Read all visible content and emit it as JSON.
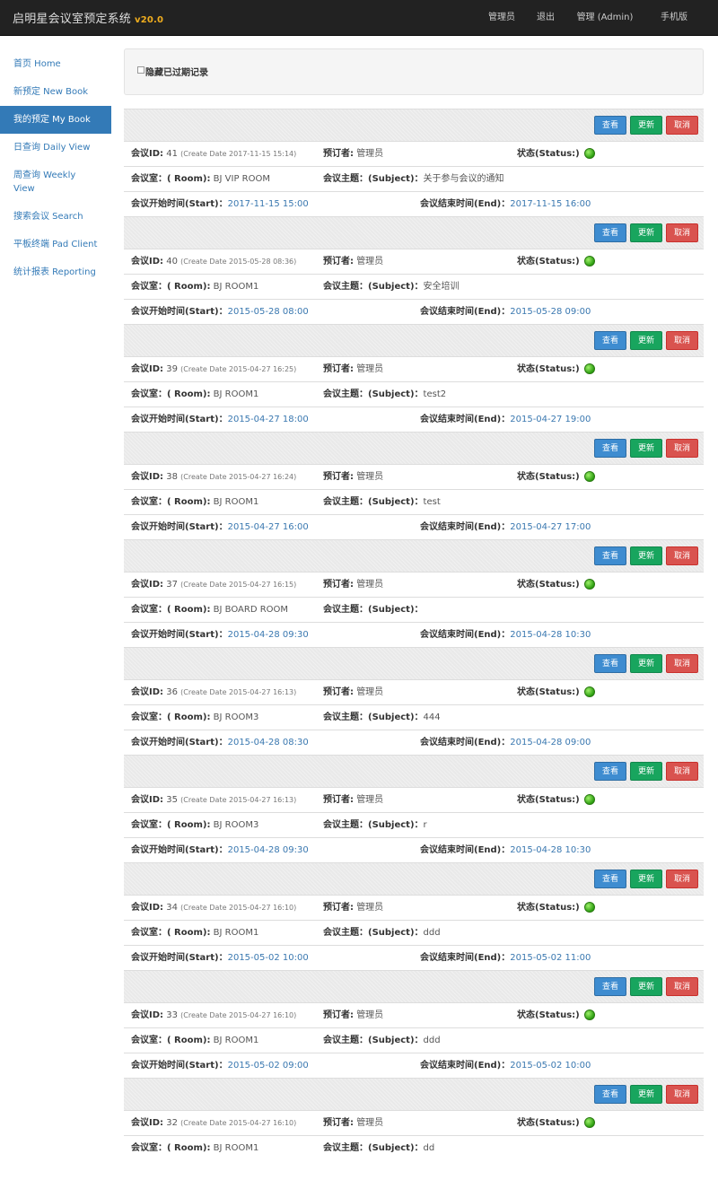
{
  "app": {
    "title": "启明星会议室预定系统",
    "version": "v20.0"
  },
  "nav": [
    {
      "label": "管理员",
      "x": 0
    },
    {
      "label": "退出"
    },
    {
      "label": "管理 (Admin)"
    },
    {
      "label": "手机版"
    }
  ],
  "sidebar": [
    {
      "label": "首页 Home",
      "active": false
    },
    {
      "label": "新预定 New Book",
      "active": false
    },
    {
      "label": "我的预定 My Book",
      "active": true
    },
    {
      "label": "日查询 Daily View",
      "active": false
    },
    {
      "label": "周查询 Weekly View",
      "active": false
    },
    {
      "label": "搜索会议 Search",
      "active": false
    },
    {
      "label": "平板终端 Pad Client",
      "active": false
    },
    {
      "label": "统计报表 Reporting",
      "active": false
    }
  ],
  "hide_expired": "隐藏已过期记录",
  "buttons": {
    "view": "查看",
    "update": "更新",
    "cancel": "取消"
  },
  "labels": {
    "id": "会议ID:",
    "booker": "预订者:",
    "status": "状态(Status:)",
    "room": "会议室：( Room):",
    "subject": "会议主题：(Subject)：",
    "start": "会议开始时间(Start)：",
    "end": "会议结束时间(End)："
  },
  "records": [
    {
      "id": "41",
      "create": "(Create Date 2017-11-15 15:14)",
      "booker": "管理员",
      "room": "BJ VIP ROOM",
      "subject": "关于参与会议的通知",
      "start": "2017-11-15 15:00",
      "end": "2017-11-15 16:00"
    },
    {
      "id": "40",
      "create": "(Create Date 2015-05-28 08:36)",
      "booker": "管理员",
      "room": "BJ ROOM1",
      "subject": "安全培训",
      "start": "2015-05-28 08:00",
      "end": "2015-05-28 09:00"
    },
    {
      "id": "39",
      "create": "(Create Date 2015-04-27 16:25)",
      "booker": "管理员",
      "room": "BJ ROOM1",
      "subject": "test2",
      "start": "2015-04-27 18:00",
      "end": "2015-04-27 19:00"
    },
    {
      "id": "38",
      "create": "(Create Date 2015-04-27 16:24)",
      "booker": "管理员",
      "room": "BJ ROOM1",
      "subject": "test",
      "start": "2015-04-27 16:00",
      "end": "2015-04-27 17:00"
    },
    {
      "id": "37",
      "create": "(Create Date 2015-04-27 16:15)",
      "booker": "管理员",
      "room": "BJ BOARD ROOM",
      "subject": "",
      "start": "2015-04-28 09:30",
      "end": "2015-04-28 10:30"
    },
    {
      "id": "36",
      "create": "(Create Date 2015-04-27 16:13)",
      "booker": "管理员",
      "room": "BJ ROOM3",
      "subject": "444",
      "start": "2015-04-28 08:30",
      "end": "2015-04-28 09:00"
    },
    {
      "id": "35",
      "create": "(Create Date 2015-04-27 16:13)",
      "booker": "管理员",
      "room": "BJ ROOM3",
      "subject": "r",
      "start": "2015-04-28 09:30",
      "end": "2015-04-28 10:30"
    },
    {
      "id": "34",
      "create": "(Create Date 2015-04-27 16:10)",
      "booker": "管理员",
      "room": "BJ ROOM1",
      "subject": "ddd",
      "start": "2015-05-02 10:00",
      "end": "2015-05-02 11:00"
    },
    {
      "id": "33",
      "create": "(Create Date 2015-04-27 16:10)",
      "booker": "管理员",
      "room": "BJ ROOM1",
      "subject": "ddd",
      "start": "2015-05-02 09:00",
      "end": "2015-05-02 10:00"
    },
    {
      "id": "32",
      "create": "(Create Date 2015-04-27 16:10)",
      "booker": "管理员",
      "room": "BJ ROOM1",
      "subject": "dd",
      "start": "",
      "end": ""
    }
  ]
}
